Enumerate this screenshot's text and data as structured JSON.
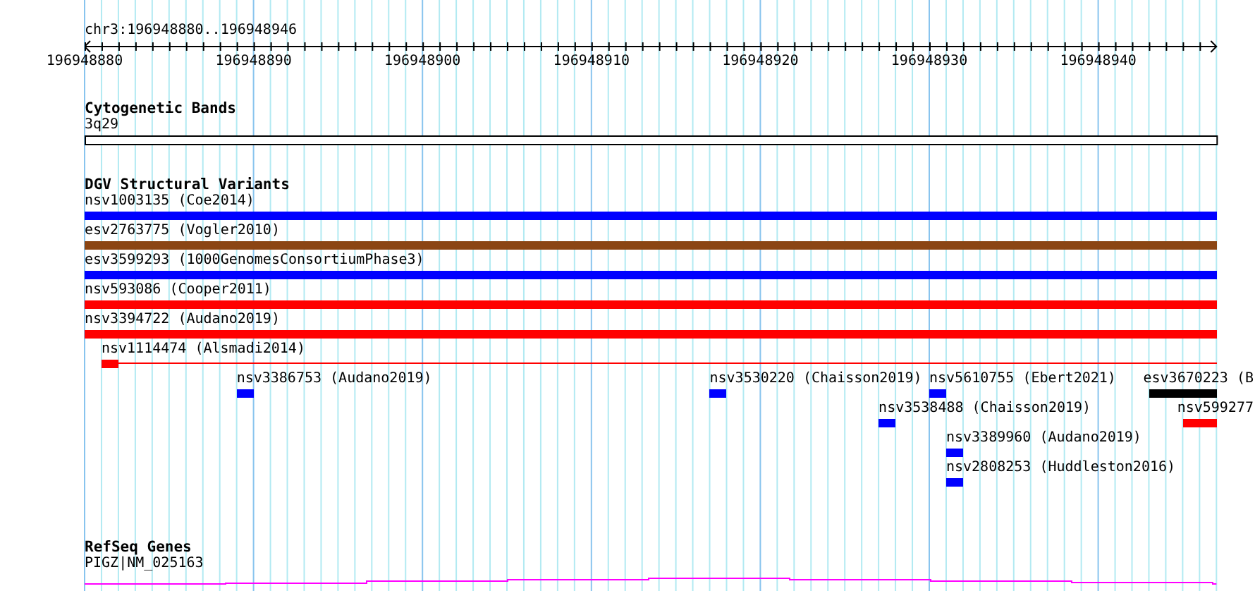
{
  "ruler": {
    "title": "chr3:196948880..196948946",
    "ticks": [
      "196948880",
      "196948890",
      "196948900",
      "196948910",
      "196948920",
      "196948930",
      "196948940"
    ]
  },
  "cytogenetic_track": {
    "title": "Cytogenetic Bands",
    "band": "3q29"
  },
  "dgv_track": {
    "title": "DGV Structural Variants",
    "lanes": [
      {
        "variants": [
          {
            "kind": "bar",
            "label": "nsv1003135 (Coe2014)",
            "color": "#0000ff"
          }
        ]
      },
      {
        "variants": [
          {
            "kind": "bar",
            "label": "esv2763775 (Vogler2010)",
            "color": "#8b4513"
          }
        ]
      },
      {
        "variants": [
          {
            "kind": "bar",
            "label": "esv3599293 (1000GenomesConsortiumPhase3)",
            "color": "#0000ff"
          }
        ]
      },
      {
        "variants": [
          {
            "kind": "bar",
            "label": "nsv593086 (Cooper2011)",
            "color": "#ff0000"
          }
        ]
      },
      {
        "variants": [
          {
            "kind": "bar",
            "label": "nsv3394722 (Audano2019)",
            "color": "#ff0000"
          }
        ]
      },
      {
        "variants": [
          {
            "kind": "tail",
            "label": "nsv1114474 (Alsmadi2014)",
            "color": "#ff0000"
          }
        ]
      },
      {
        "variants": [
          {
            "kind": "bar",
            "label": "nsv3386753 (Audano2019)",
            "color": "#0000ff"
          },
          {
            "kind": "bar",
            "label": "nsv3530220 (Chaisson2019)",
            "color": "#0000ff"
          },
          {
            "kind": "bar",
            "label": "nsv5610755 (Ebert2021)",
            "color": "#0000ff"
          },
          {
            "kind": "bar",
            "label": "esv3670223 (B",
            "color": "#000000"
          }
        ]
      },
      {
        "variants": [
          {
            "kind": "bar",
            "label": "nsv3538488 (Chaisson2019)",
            "color": "#0000ff"
          },
          {
            "kind": "bar",
            "label": "nsv599277",
            "color": "#ff0000"
          }
        ]
      },
      {
        "variants": [
          {
            "kind": "bar",
            "label": "nsv3389960 (Audano2019)",
            "color": "#0000ff"
          }
        ]
      },
      {
        "variants": [
          {
            "kind": "bar",
            "label": "nsv2808253 (Huddleston2016)",
            "color": "#0000ff"
          }
        ]
      }
    ]
  },
  "refseq_track": {
    "title": "RefSeq Genes",
    "gene": "PIGZ|NM_025163"
  }
}
